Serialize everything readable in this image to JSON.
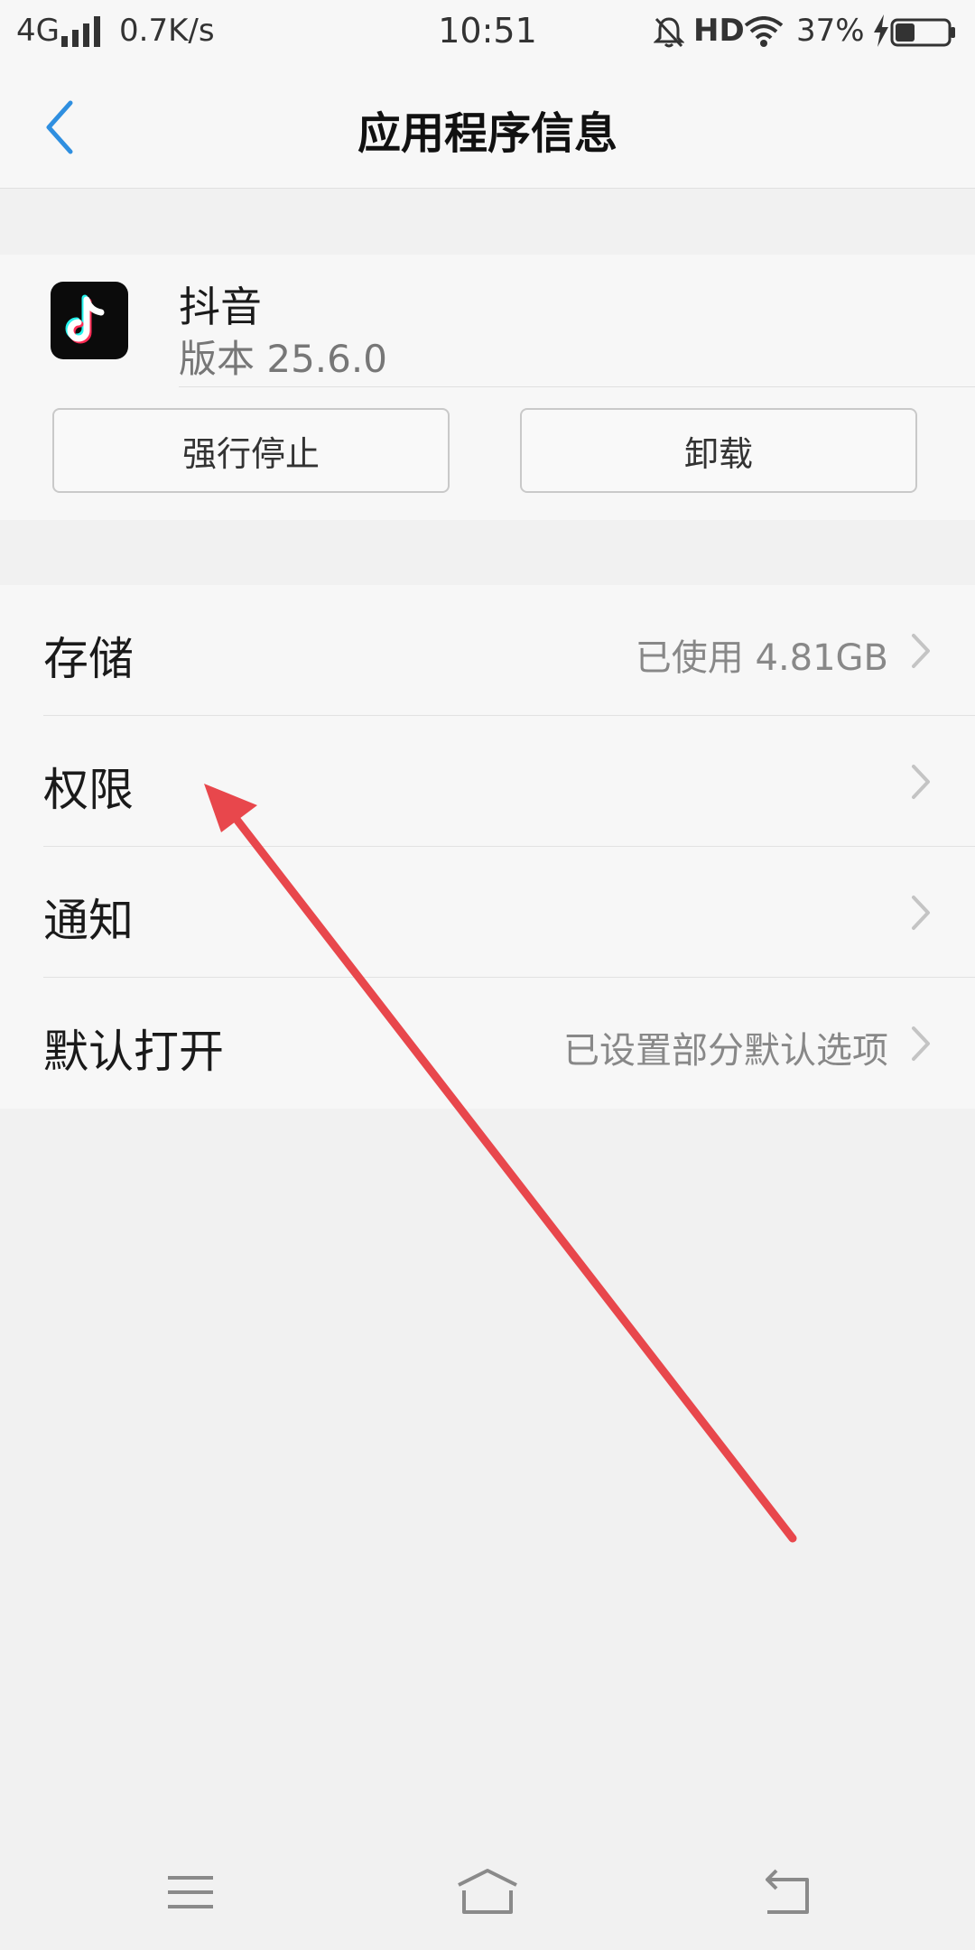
{
  "status_bar": {
    "network": "4G",
    "speed": "0.7K/s",
    "time": "10:51",
    "hd": "HD",
    "battery_percent": "37%",
    "battery_level": 0.37,
    "icons": [
      "signal-bars-icon",
      "bell-off-icon",
      "wifi-icon",
      "charging-bolt-icon",
      "battery-icon"
    ]
  },
  "header": {
    "title": "应用程序信息",
    "back_icon": "chevron-left-icon",
    "accent_color": "#2f8fe0"
  },
  "app": {
    "name": "抖音",
    "version": "版本 25.6.0",
    "icon": "tiktok-logo-icon",
    "buttons": {
      "force_stop": "强行停止",
      "uninstall": "卸载"
    }
  },
  "settings": {
    "items": [
      {
        "label": "存储",
        "value": "已使用 4.81GB"
      },
      {
        "label": "权限",
        "value": ""
      },
      {
        "label": "通知",
        "value": ""
      },
      {
        "label": "默认打开",
        "value": "已设置部分默认选项"
      }
    ]
  },
  "annotation": {
    "color": "#e8474c",
    "icon": "red-arrow-pointing-to-permissions"
  },
  "nav": {
    "icons": [
      "menu-icon",
      "home-icon",
      "back-icon"
    ]
  }
}
